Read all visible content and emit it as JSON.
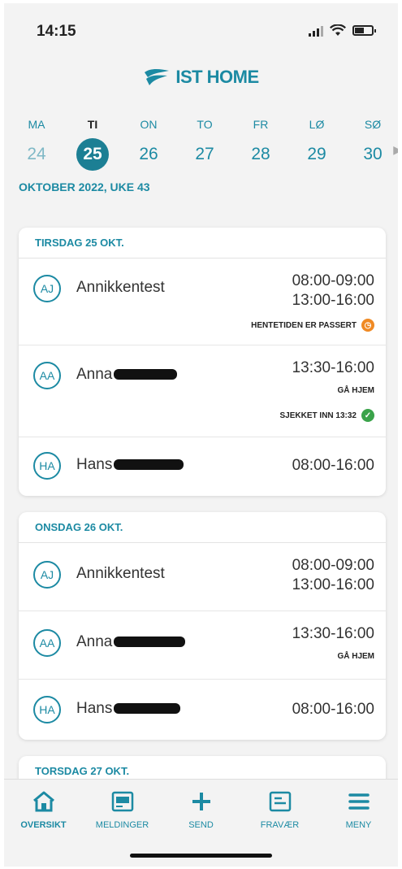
{
  "status": {
    "time": "14:15"
  },
  "app": {
    "logo_text": "IST HOME",
    "accent": "#1c8aa3"
  },
  "calendar": {
    "days": [
      {
        "dn": "MA",
        "num": "24"
      },
      {
        "dn": "TI",
        "num": "25"
      },
      {
        "dn": "ON",
        "num": "26"
      },
      {
        "dn": "TO",
        "num": "27"
      },
      {
        "dn": "FR",
        "num": "28"
      },
      {
        "dn": "LØ",
        "num": "29"
      },
      {
        "dn": "SØ",
        "num": "30"
      }
    ],
    "month_label": "OKTOBER 2022, UKE 43"
  },
  "cards": [
    {
      "title": "TIRSDAG 25 OKT.",
      "rows": [
        {
          "initials": "AJ",
          "name": "Annikkentest",
          "time1": "08:00-09:00",
          "time2": "13:00-16:00",
          "status": "HENTETIDEN ER PASSERT"
        },
        {
          "initials": "AA",
          "name": "Anna",
          "time1": "13:30-16:00",
          "note": "GÅ HJEM",
          "status": "SJEKKET INN 13:32"
        },
        {
          "initials": "HA",
          "name": "Hans",
          "time1": "08:00-16:00"
        }
      ]
    },
    {
      "title": "ONSDAG 26 OKT.",
      "rows": [
        {
          "initials": "AJ",
          "name": "Annikkentest",
          "time1": "08:00-09:00",
          "time2": "13:00-16:00"
        },
        {
          "initials": "AA",
          "name": "Anna",
          "time1": "13:30-16:00",
          "note": "GÅ HJEM"
        },
        {
          "initials": "HA",
          "name": "Hans",
          "time1": "08:00-16:00"
        }
      ]
    },
    {
      "title": "TORSDAG 27 OKT."
    }
  ],
  "nav": {
    "tabs": [
      {
        "label": "OVERSIKT",
        "icon": "home-icon"
      },
      {
        "label": "MELDINGER",
        "icon": "messages-icon"
      },
      {
        "label": "SEND",
        "icon": "plus-icon"
      },
      {
        "label": "FRAVÆR",
        "icon": "absence-icon"
      },
      {
        "label": "MENY",
        "icon": "menu-icon"
      }
    ]
  }
}
